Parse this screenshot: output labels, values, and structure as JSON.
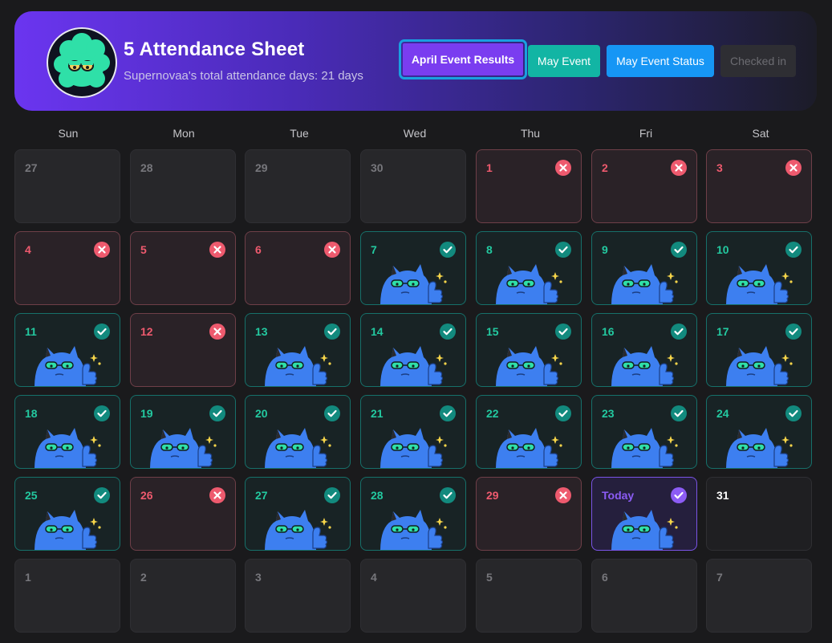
{
  "header": {
    "title": "5 Attendance Sheet",
    "subtitle": "Supernovaa's total attendance days: 21 days",
    "buttons": {
      "april": "April Event Results",
      "may": "May Event",
      "status": "May Event Status",
      "checked": "Checked in"
    }
  },
  "weekdays": [
    "Sun",
    "Mon",
    "Tue",
    "Wed",
    "Thu",
    "Fri",
    "Sat"
  ],
  "colors": {
    "accent": "#7a3df0",
    "checked": "#12b5a4",
    "missed": "#ee5a6e",
    "today": "#8c5cf5"
  },
  "calendar": [
    {
      "label": "27",
      "state": "muted"
    },
    {
      "label": "28",
      "state": "muted"
    },
    {
      "label": "29",
      "state": "muted"
    },
    {
      "label": "30",
      "state": "muted"
    },
    {
      "label": "1",
      "state": "miss"
    },
    {
      "label": "2",
      "state": "miss"
    },
    {
      "label": "3",
      "state": "miss"
    },
    {
      "label": "4",
      "state": "miss"
    },
    {
      "label": "5",
      "state": "miss"
    },
    {
      "label": "6",
      "state": "miss"
    },
    {
      "label": "7",
      "state": "done"
    },
    {
      "label": "8",
      "state": "done"
    },
    {
      "label": "9",
      "state": "done"
    },
    {
      "label": "10",
      "state": "done"
    },
    {
      "label": "11",
      "state": "done"
    },
    {
      "label": "12",
      "state": "miss"
    },
    {
      "label": "13",
      "state": "done"
    },
    {
      "label": "14",
      "state": "done"
    },
    {
      "label": "15",
      "state": "done"
    },
    {
      "label": "16",
      "state": "done"
    },
    {
      "label": "17",
      "state": "done"
    },
    {
      "label": "18",
      "state": "done"
    },
    {
      "label": "19",
      "state": "done"
    },
    {
      "label": "20",
      "state": "done"
    },
    {
      "label": "21",
      "state": "done"
    },
    {
      "label": "22",
      "state": "done"
    },
    {
      "label": "23",
      "state": "done"
    },
    {
      "label": "24",
      "state": "done"
    },
    {
      "label": "25",
      "state": "done"
    },
    {
      "label": "26",
      "state": "miss"
    },
    {
      "label": "27",
      "state": "done"
    },
    {
      "label": "28",
      "state": "done"
    },
    {
      "label": "29",
      "state": "miss"
    },
    {
      "label": "Today",
      "state": "today"
    },
    {
      "label": "31",
      "state": "plain"
    },
    {
      "label": "1",
      "state": "muted"
    },
    {
      "label": "2",
      "state": "muted"
    },
    {
      "label": "3",
      "state": "muted"
    },
    {
      "label": "4",
      "state": "muted"
    },
    {
      "label": "5",
      "state": "muted"
    },
    {
      "label": "6",
      "state": "muted"
    },
    {
      "label": "7",
      "state": "muted"
    }
  ]
}
